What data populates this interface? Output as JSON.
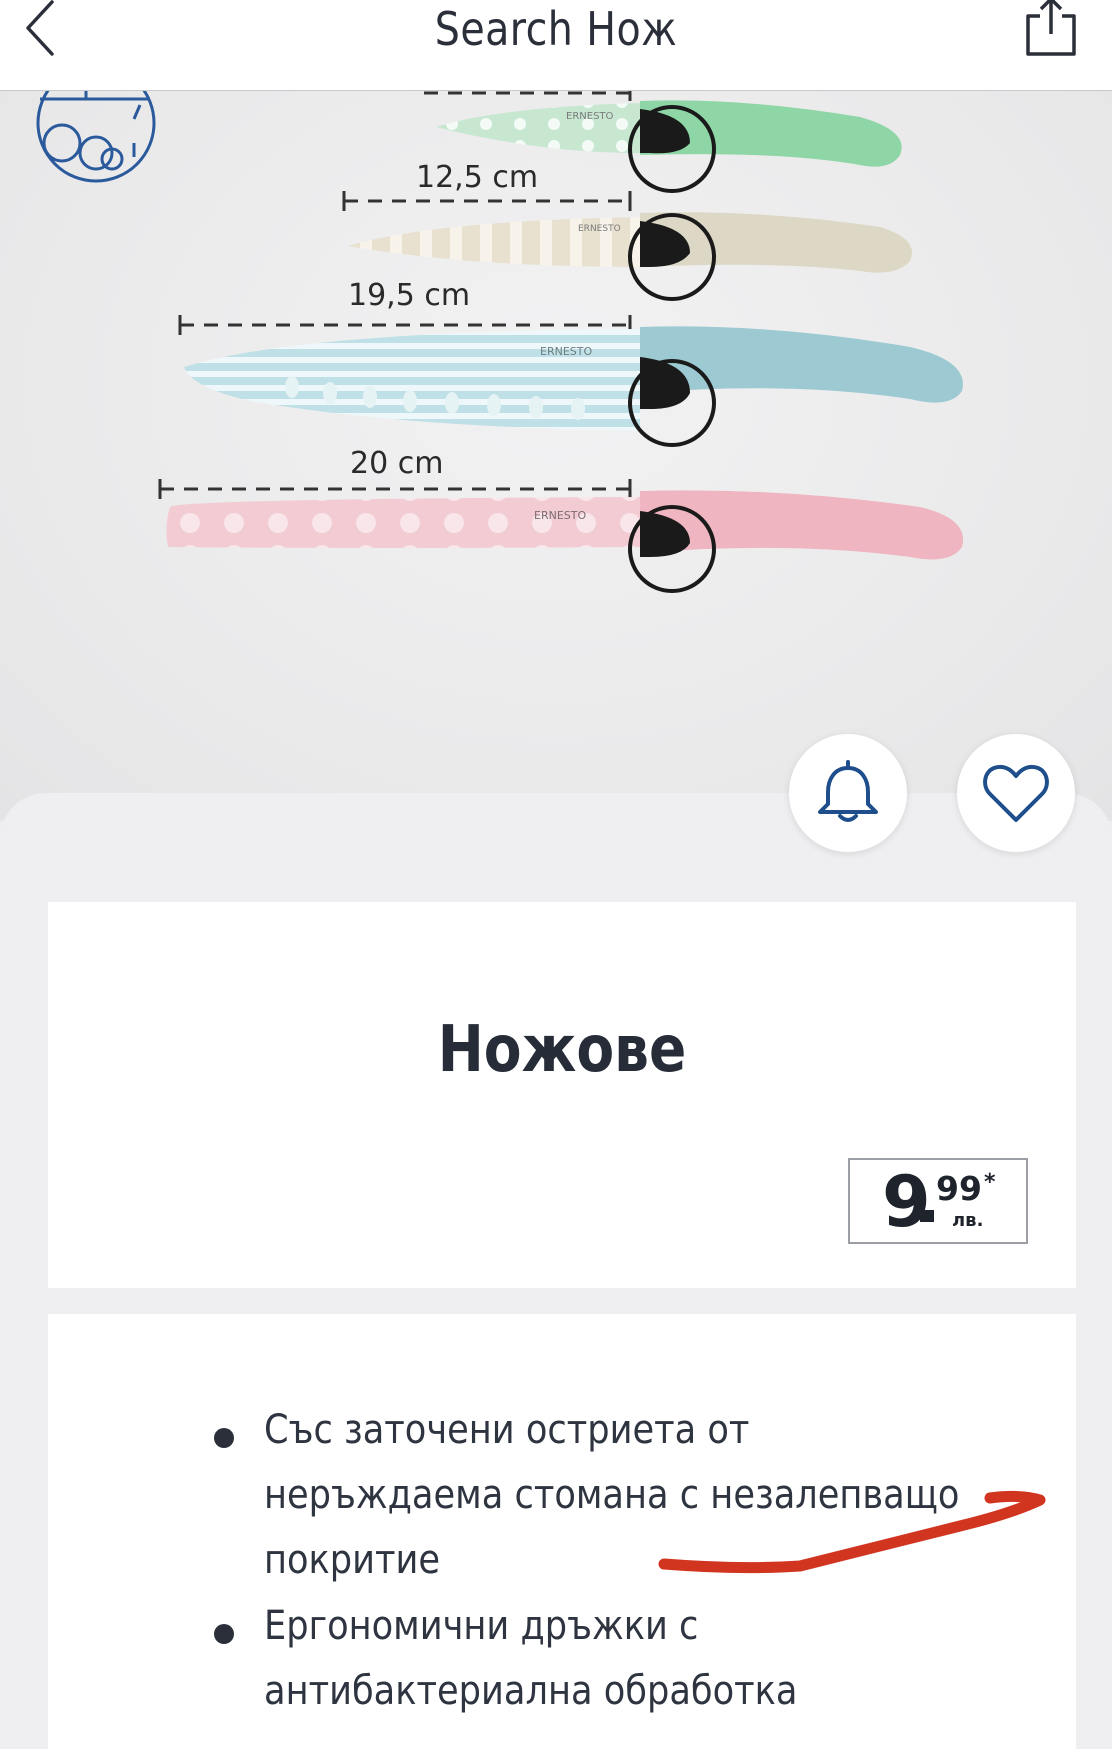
{
  "header": {
    "title": "Search Нож",
    "back_icon": "chevron-left-icon",
    "share_icon": "share-icon"
  },
  "product_image": {
    "badge_icon": "dishwasher-icon",
    "brand": "ERNESTO",
    "measurements": [
      "12,5 cm",
      "19,5 cm",
      "20 cm"
    ],
    "knife_handle_colors": [
      "#8fd6a7",
      "#ddd8c6",
      "#9cc9d2",
      "#efb5c1"
    ]
  },
  "actions": {
    "notify_icon": "bell-icon",
    "favorite_icon": "heart-icon"
  },
  "product": {
    "name": "Ножове",
    "price": {
      "integer": "9",
      "decimals": "99",
      "asterisk": "*",
      "currency": "лв."
    }
  },
  "features": [
    [
      "Със заточени остриета от",
      "неръждаема стомана с незалепващо",
      "покритие"
    ],
    [
      "Ергономични дръжки с",
      "антибактериална обработка"
    ]
  ],
  "colors": {
    "accent_blue": "#1f4e8c",
    "annotation_red": "#d1351f",
    "text_dark": "#262c38"
  }
}
